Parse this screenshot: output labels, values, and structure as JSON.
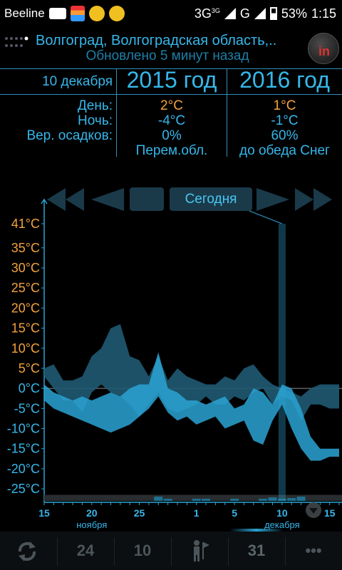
{
  "status": {
    "carrier": "Beeline",
    "net1": "3G",
    "net1_sup": "3G",
    "net2": "G",
    "battery": "53%",
    "time": "1:15"
  },
  "header": {
    "city": "Волгоград, Волгоградская область,..",
    "updated": "Обновлено 5 минут назад",
    "logo_text": "in"
  },
  "compare": {
    "date": "10 декабря",
    "year1": "2015 год",
    "year2": "2016 год",
    "labels": {
      "day": "День:",
      "night": "Ночь:",
      "precip": "Вер. осадков:"
    },
    "y2015": {
      "day": "2°C",
      "night": "-4°C",
      "precip": "0%",
      "desc": "Перем.обл."
    },
    "y2016": {
      "day": "1°C",
      "night": "-1°C",
      "precip": "60%",
      "desc": "до обеда Снег"
    }
  },
  "nav": {
    "today_label": "Сегодня"
  },
  "colors": {
    "accent": "#36b7ea",
    "warm": "#f3a23a",
    "band_dark": "#1f5a73",
    "band_light": "#2aa3d3"
  },
  "chart_data": {
    "type": "area",
    "y_ticks": [
      "41°C",
      "35°C",
      "30°C",
      "25°C",
      "20°C",
      "15°C",
      "10°C",
      "5°C",
      "0°C",
      "-5°C",
      "-10°C",
      "-15°C",
      "-20°C",
      "-25°C"
    ],
    "y_tick_values": [
      41,
      35,
      30,
      25,
      20,
      15,
      10,
      5,
      0,
      -5,
      -10,
      -15,
      -20,
      -25
    ],
    "ylim": [
      -28,
      41
    ],
    "x_ticks": [
      "15",
      "20",
      "25",
      "1",
      "5",
      "10",
      "15"
    ],
    "x_tick_days": [
      0,
      5,
      10,
      16,
      20,
      25,
      30
    ],
    "month_labels": [
      "ноября",
      "декабря"
    ],
    "month_label_days": [
      5,
      25
    ],
    "today_day": 25,
    "series": [
      {
        "name": "2015",
        "days": [
          0,
          1,
          2,
          3,
          4,
          5,
          6,
          7,
          8,
          9,
          10,
          11,
          12,
          13,
          14,
          15,
          16,
          17,
          18,
          19,
          20,
          21,
          22,
          23,
          24,
          25,
          26,
          27,
          28,
          29,
          30,
          31
        ],
        "high": [
          5,
          6,
          2,
          2,
          3,
          8,
          10,
          15,
          16,
          8,
          7,
          3,
          8,
          2,
          5,
          3,
          2,
          1,
          1,
          3,
          2,
          5,
          6,
          3,
          1,
          0,
          -1,
          -2,
          0,
          1,
          1,
          1
        ],
        "low": [
          3,
          0,
          -3,
          -3,
          -6,
          -1,
          1,
          -1,
          -2,
          -4,
          -7,
          -4,
          -1,
          -5,
          -6,
          -5,
          -4,
          -2,
          -4,
          -4,
          -2,
          -3,
          -1,
          0,
          -4,
          -2,
          -3,
          -8,
          -4,
          -4,
          -5,
          -5
        ]
      },
      {
        "name": "2016",
        "days": [
          0,
          1,
          2,
          3,
          4,
          5,
          6,
          7,
          8,
          9,
          10,
          11,
          12,
          13,
          14,
          15,
          16,
          17,
          18,
          19,
          20,
          21,
          22,
          23,
          24,
          25,
          26,
          27,
          28,
          29,
          30,
          31
        ],
        "high": [
          1,
          -1,
          -2,
          -3,
          -2,
          -3,
          -2,
          -1,
          -2,
          0,
          1,
          1,
          9,
          0,
          -1,
          -3,
          -3,
          -4,
          -3,
          -2,
          -5,
          -4,
          0,
          -1,
          -4,
          1,
          0,
          -5,
          -12,
          -15,
          -15,
          -15
        ],
        "low": [
          -3,
          -5,
          -6,
          -7,
          -8,
          -9,
          -10,
          -11,
          -10,
          -9,
          -7,
          -5,
          -2,
          -6,
          -8,
          -7,
          -9,
          -8,
          -7,
          -10,
          -9,
          -8,
          -13,
          -14,
          -8,
          -4,
          -10,
          -15,
          -18,
          -18,
          -17,
          -17
        ]
      }
    ],
    "precip_bars": [
      0,
      0,
      0,
      0,
      0,
      0,
      0,
      0,
      0,
      0,
      0,
      0,
      0.6,
      0.3,
      0,
      0,
      0.3,
      0.3,
      0,
      0,
      0.3,
      0,
      0,
      0.3,
      0.5,
      0.3,
      0.4,
      0.6,
      0,
      0,
      0,
      0
    ]
  },
  "bottom": {
    "refresh": "refresh-icon",
    "d1": "24",
    "d2": "10",
    "pin": "walker-icon",
    "d3": "31",
    "more": "•••"
  }
}
